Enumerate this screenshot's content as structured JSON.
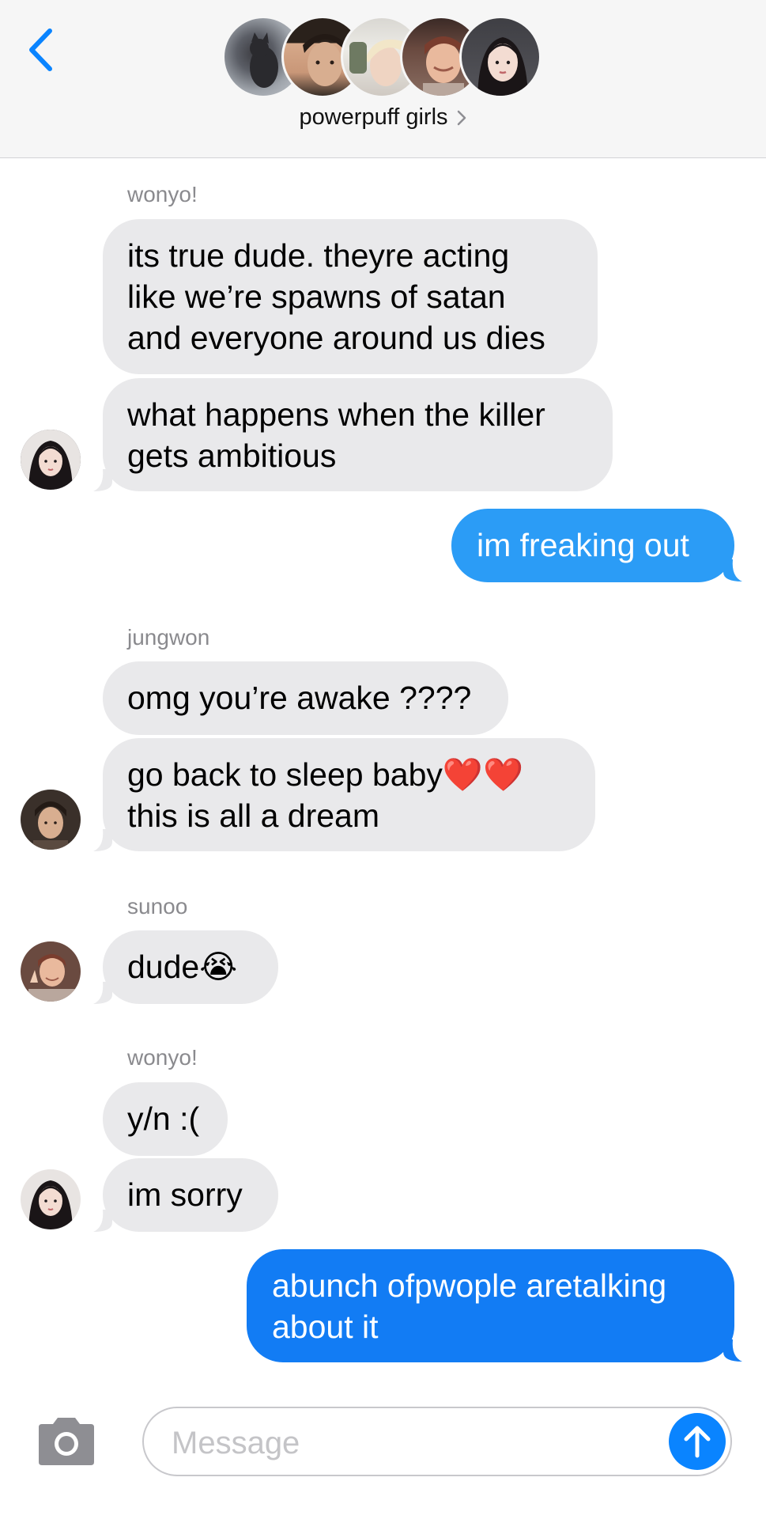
{
  "header": {
    "group_name": "powerpuff girls",
    "back_icon": "chevron-left-icon"
  },
  "messages": [
    {
      "sender": "wonyo!",
      "text": "its true dude. theyre acting\nlike we’re spawns of satan\nand everyone around us dies"
    },
    {
      "text": "what happens when the killer\ngets ambitious"
    },
    {
      "text": "im freaking out"
    },
    {
      "sender": "jungwon",
      "text": "omg you’re awake ????"
    },
    {
      "text": "go back to sleep baby❤️❤️\nthis is all a dream"
    },
    {
      "sender": "sunoo",
      "text": "dude😭"
    },
    {
      "sender": "wonyo!",
      "text": "y/n :("
    },
    {
      "text": "im sorry"
    },
    {
      "text": "abunch ofpwople aretalking\nabout it"
    }
  ],
  "composer": {
    "placeholder": "Message",
    "camera_icon": "camera-icon",
    "send_icon": "arrow-up-icon"
  },
  "colors": {
    "incoming": "#e9e9eb",
    "outgoing": "#2b9cf6",
    "outgoing_last": "#127cf4",
    "accent": "#0a84ff"
  }
}
